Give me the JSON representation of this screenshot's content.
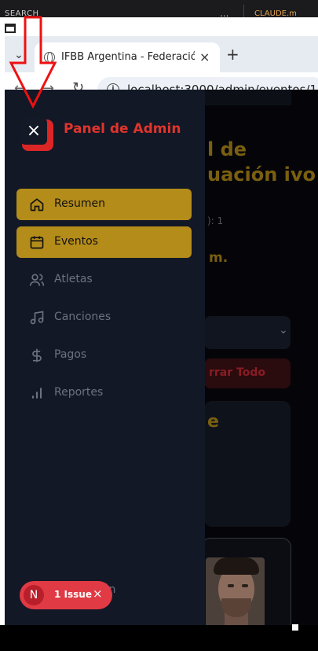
{
  "top_strip": {
    "search_label": "SEARCH",
    "more_label": "...",
    "right_label": "CLAUDE.m"
  },
  "browser": {
    "tab_title": "IFBB Argentina - Federació",
    "tab_close": "×",
    "new_tab": "+",
    "url": "localhost:3000/admin/eventos/1/p",
    "info_symbol": "i"
  },
  "sidebar": {
    "close_symbol": "×",
    "title": "Panel de Admin",
    "items": [
      {
        "label": "Resumen",
        "icon": "home-icon",
        "active": true
      },
      {
        "label": "Eventos",
        "icon": "calendar-icon",
        "active": true
      },
      {
        "label": "Atletas",
        "icon": "users-icon",
        "active": false
      },
      {
        "label": "Canciones",
        "icon": "music-icon",
        "active": false
      },
      {
        "label": "Pagos",
        "icon": "dollar-icon",
        "active": false
      },
      {
        "label": "Reportes",
        "icon": "bar-chart-icon",
        "active": false
      }
    ],
    "bottom_label": "ión"
  },
  "background_page": {
    "heading": "l de uación ivo",
    "sub": "): 1",
    "time": "m.",
    "clear_button": "rrar Todo",
    "card_text": "e"
  },
  "issue": {
    "badge": "N",
    "label": "1 Issue",
    "close": "×"
  },
  "colors": {
    "accent": "#b48c1a",
    "brand_red": "#e0342c",
    "sidebar_bg": "#121826"
  }
}
